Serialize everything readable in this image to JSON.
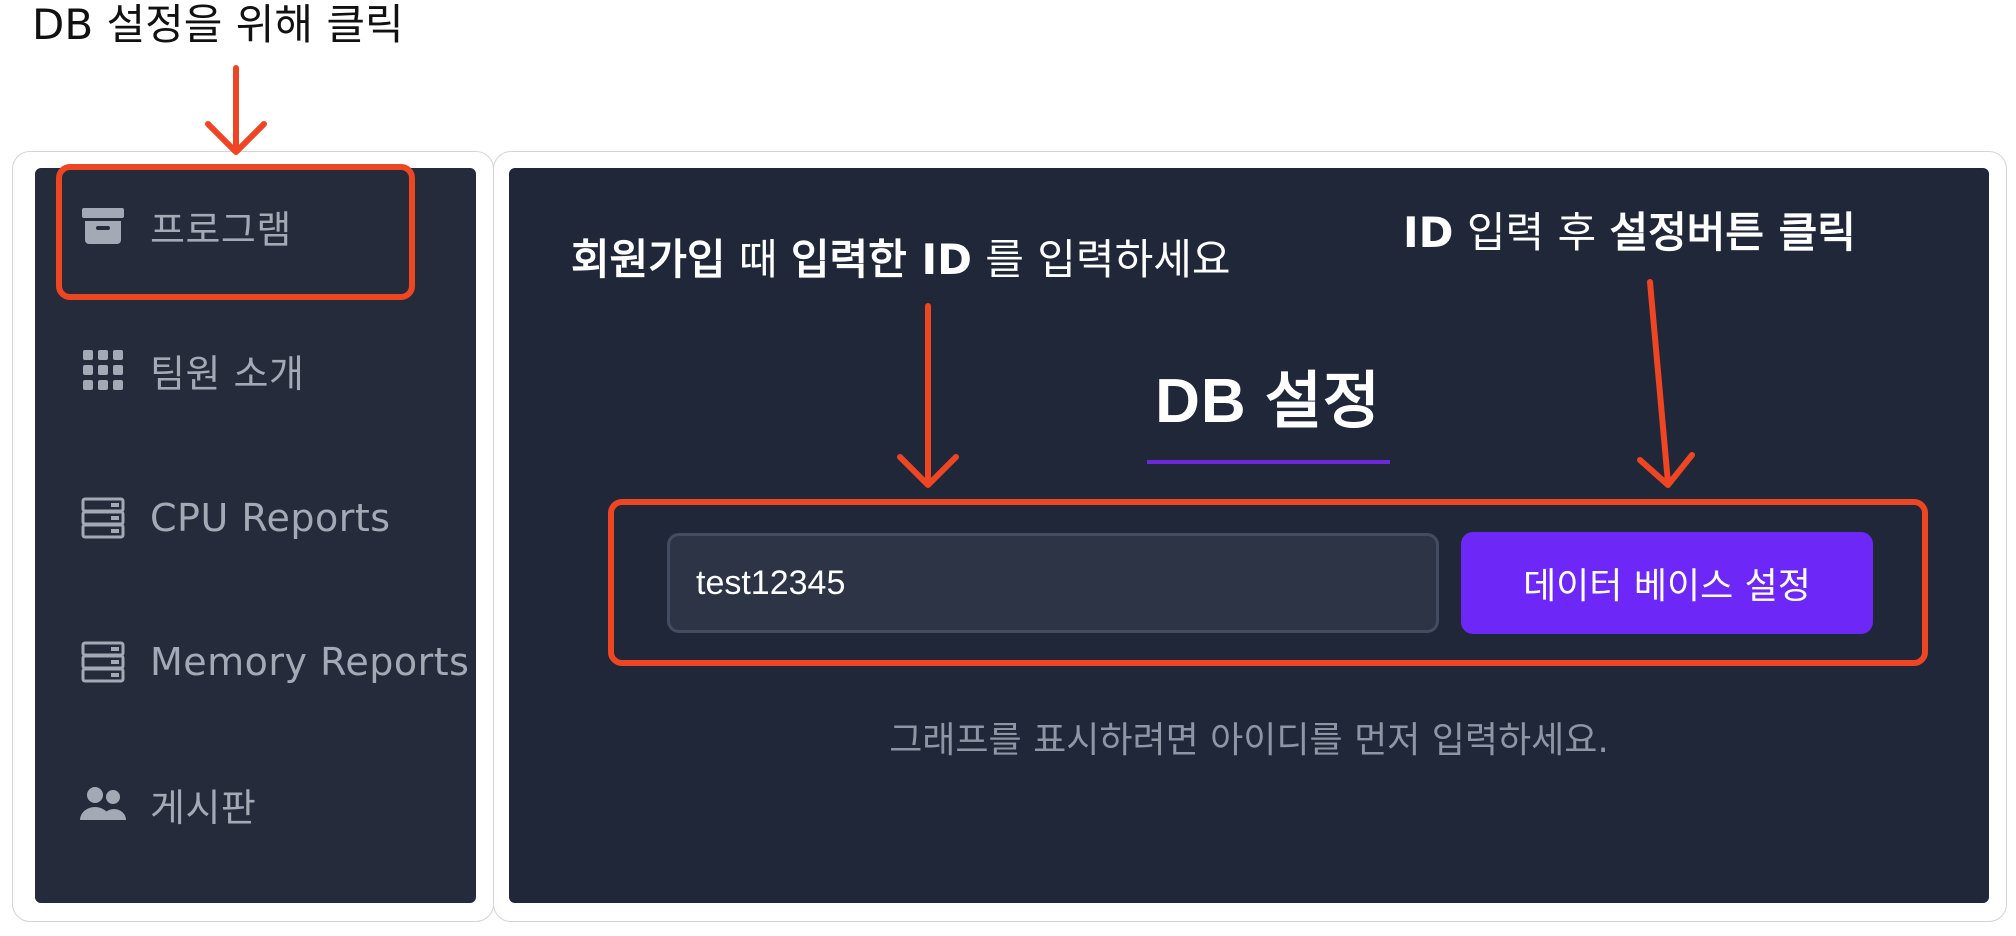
{
  "annotations": {
    "top_caption": "DB 설정을 위해 클릭",
    "input_hint": {
      "p1": "회원가입",
      "p2": " 때 ",
      "p3": "입력한 ID",
      "p4": " 를 입력하세요"
    },
    "button_hint": {
      "p1": "ID",
      "p2": " 입력 후 ",
      "p3": "설정버튼 클릭"
    },
    "arrow_color": "#ee4522"
  },
  "sidebar": {
    "items": [
      {
        "label": "프로그램",
        "icon": "archive-icon"
      },
      {
        "label": "팀원 소개",
        "icon": "grid-icon"
      },
      {
        "label": "CPU Reports",
        "icon": "server-icon"
      },
      {
        "label": "Memory Reports",
        "icon": "server-icon"
      },
      {
        "label": "게시판",
        "icon": "users-icon"
      }
    ]
  },
  "main": {
    "title": "DB 설정",
    "input_value": "test12345",
    "button_label": "데이터 베이스 설정",
    "hint": "그래프를 표시하려면 아이디를 먼저 입력하세요."
  },
  "colors": {
    "sidebar_bg": "#252b3b",
    "main_bg": "#1f2739",
    "accent": "#6d28f7",
    "highlight": "#ee4522"
  }
}
